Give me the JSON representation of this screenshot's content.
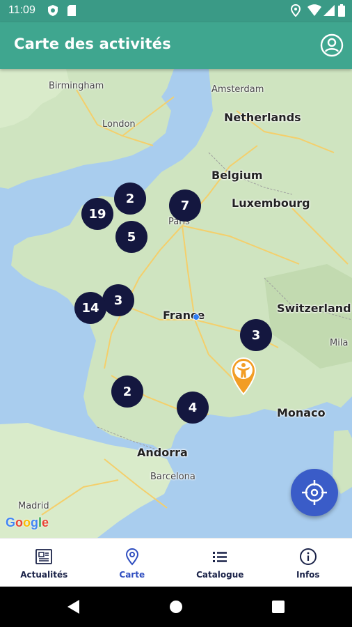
{
  "status_bar": {
    "time": "11:09"
  },
  "app_bar": {
    "title": "Carte des activités"
  },
  "map": {
    "labels": {
      "birmingham": "Birmingham",
      "london": "London",
      "amsterdam": "Amsterdam",
      "netherlands": "Netherlands",
      "belgium": "Belgium",
      "luxembourg": "Luxembourg",
      "paris": "Paris",
      "france": "France",
      "switzerland": "Switzerland",
      "milan": "Mila",
      "monaco": "Monaco",
      "andorra": "Andorra",
      "barcelona": "Barcelona",
      "madrid": "Madrid"
    },
    "clusters": [
      "2",
      "19",
      "7",
      "5",
      "3",
      "14",
      "3",
      "2",
      "4"
    ],
    "google_logo": "Google"
  },
  "bottom_nav": {
    "items": [
      {
        "label": "Actualités",
        "icon": "newspaper-icon"
      },
      {
        "label": "Carte",
        "icon": "map-pin-icon",
        "active": true
      },
      {
        "label": "Catalogue",
        "icon": "list-icon"
      },
      {
        "label": "Infos",
        "icon": "info-icon"
      }
    ]
  },
  "colors": {
    "primary": "#3fa68f",
    "cluster": "#14173f",
    "accent_blue": "#3a5cc8",
    "pin": "#f29d25"
  }
}
